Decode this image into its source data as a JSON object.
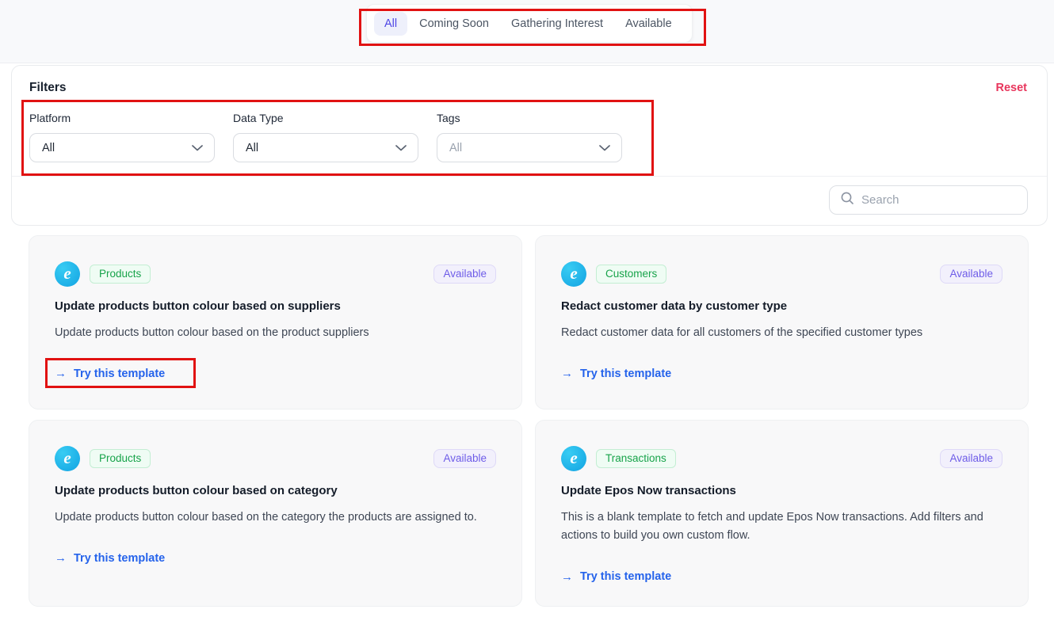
{
  "tabs": {
    "active": "All",
    "items": [
      {
        "label": "All"
      },
      {
        "label": "Coming Soon"
      },
      {
        "label": "Gathering Interest"
      },
      {
        "label": "Available"
      }
    ]
  },
  "filters": {
    "title": "Filters",
    "reset_label": "Reset",
    "fields": [
      {
        "label": "Platform",
        "value": "All"
      },
      {
        "label": "Data Type",
        "value": "All"
      },
      {
        "label": "Tags",
        "placeholder": "All"
      }
    ]
  },
  "search": {
    "placeholder": "Search"
  },
  "cards": [
    {
      "tag": "Products",
      "status": "Available",
      "title": "Update products button colour based on suppliers",
      "description": "Update products button colour based on the product suppliers",
      "cta_label": "Try this template"
    },
    {
      "tag": "Customers",
      "status": "Available",
      "title": "Redact customer data by customer type",
      "description": "Redact customer data for all customers of the specified customer types",
      "cta_label": "Try this template"
    },
    {
      "tag": "Products",
      "status": "Available",
      "title": "Update products button colour based on category",
      "description": "Update products button colour based on the category the products are assigned to.",
      "cta_label": "Try this template"
    },
    {
      "tag": "Transactions",
      "status": "Available",
      "title": "Update Epos Now transactions",
      "description": "This is a blank template to fetch and update Epos Now transactions. Add filters and actions to build you own custom flow.",
      "cta_label": "Try this template"
    }
  ],
  "icons": {
    "card_logo": "epos-now-logo",
    "logo_letter": "e",
    "arrow_right": "→",
    "search": "magnifier",
    "select_chevron": "chevron-down"
  },
  "colors": {
    "annotation_red": "#e11212",
    "reset_link": "#e8355c",
    "active_tab_text": "#4f46e5",
    "active_tab_bg": "#eef0fb",
    "tag_green": "#17a34a",
    "badge_purple": "#6e5ce8",
    "cta_blue": "#2563eb",
    "logo_blue": "#12a3e2",
    "card_bg": "#f8f8f9",
    "topbar_bg": "#f8f9fb"
  },
  "annotations": [
    {
      "target": "status-tab-bar"
    },
    {
      "target": "filter-dropdowns-row"
    },
    {
      "target": "first-try-template-link"
    }
  ]
}
